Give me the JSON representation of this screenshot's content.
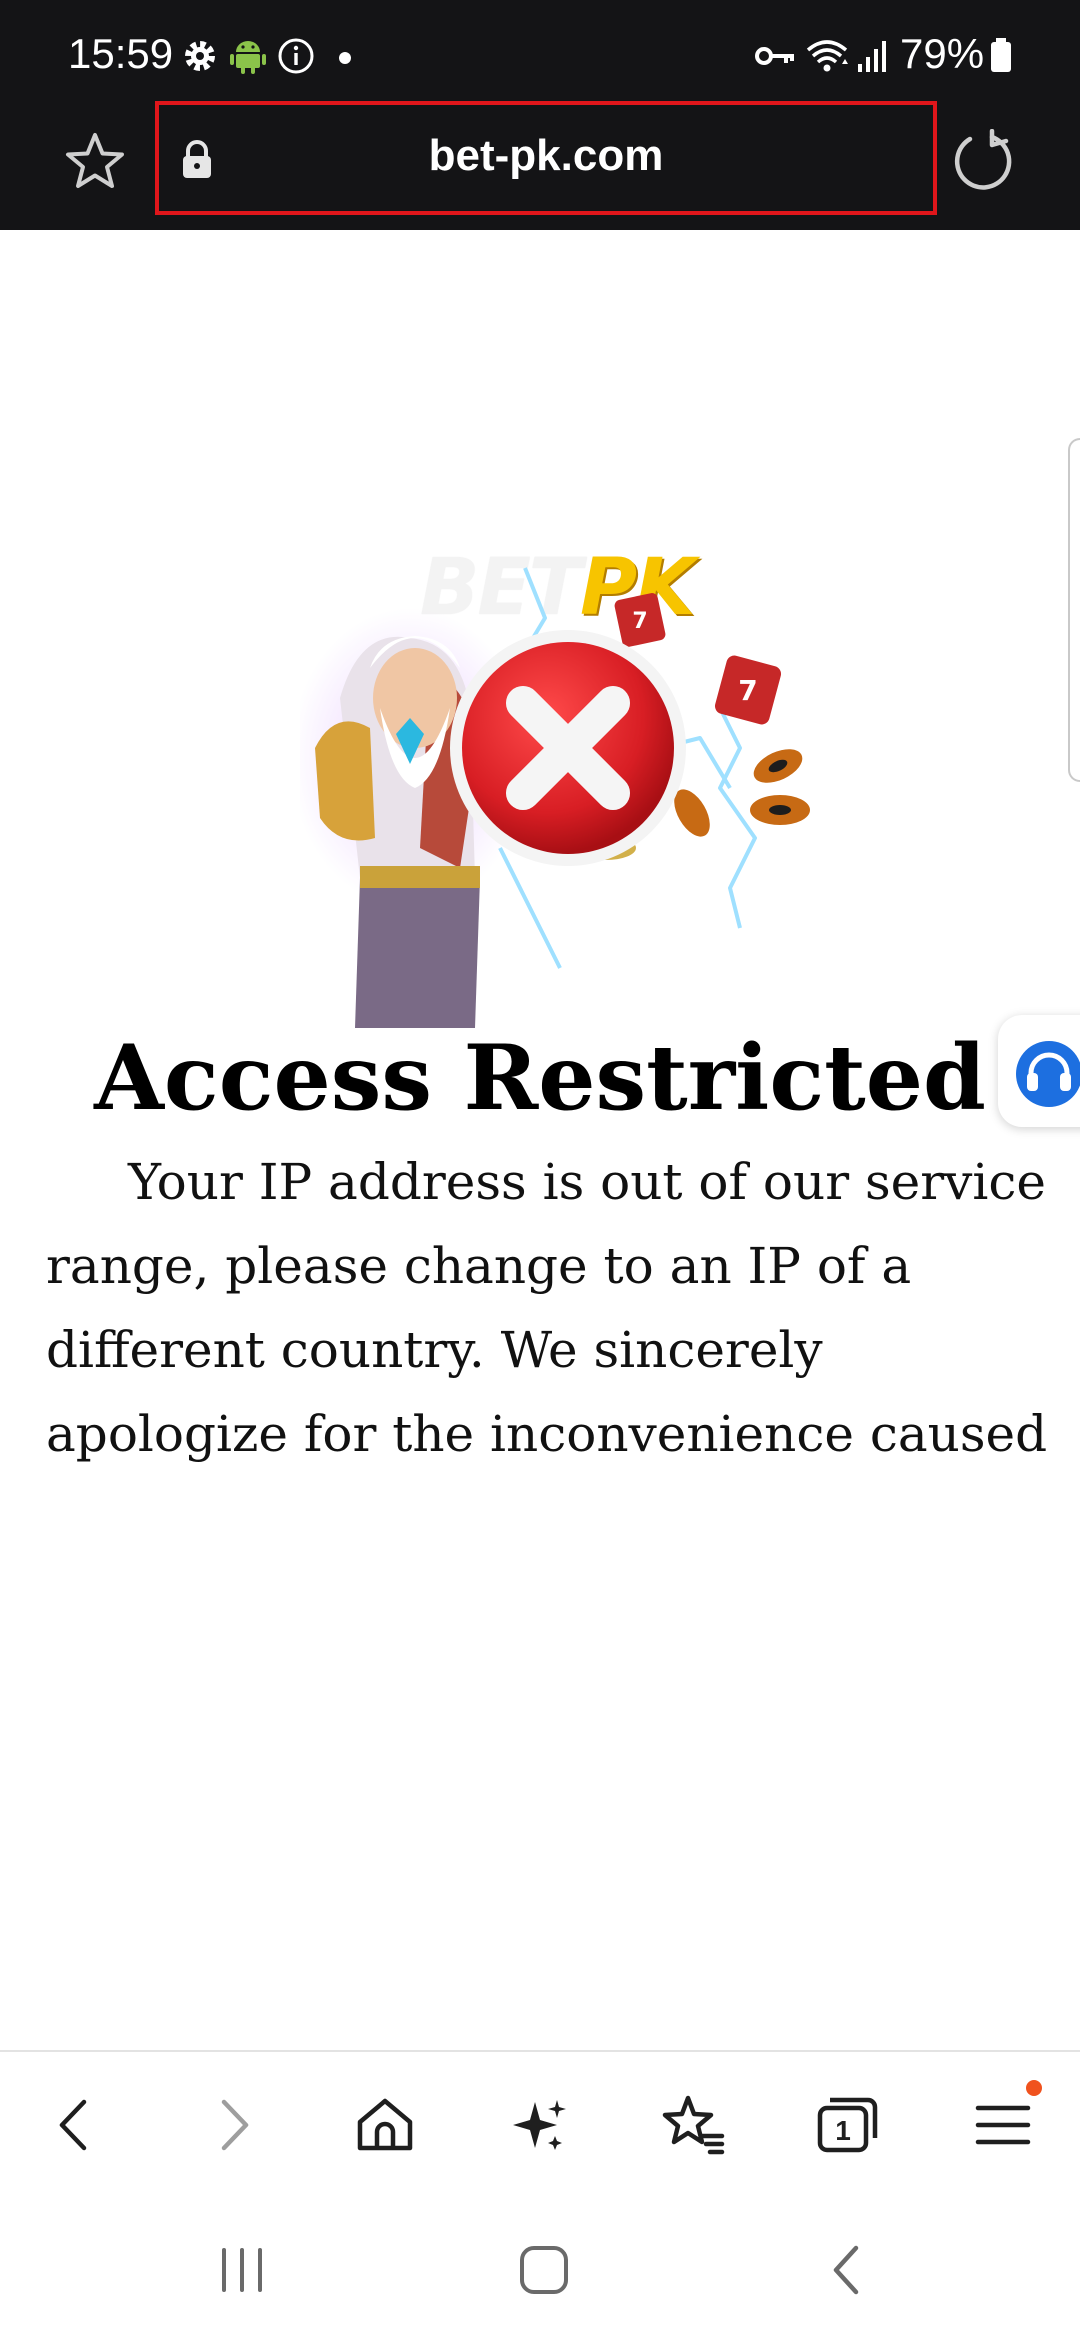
{
  "status_bar": {
    "time": "15:59",
    "battery": "79%",
    "icons": [
      "settings-icon",
      "android-icon",
      "info-icon",
      "notification-dot",
      "vpn-key-icon",
      "wifi-icon",
      "signal-icon",
      "battery-icon"
    ]
  },
  "toolbar": {
    "url": "bet-pk.com",
    "highlight_color": "#e0161b"
  },
  "page": {
    "logo": {
      "part1": "BET",
      "part2": "PK"
    },
    "title": "Access Restricted",
    "message": "Your IP address is out of our service range, please change to an IP of a different country. We sincerely apologize for the inconvenience caused"
  },
  "bottom_nav": {
    "tab_count": "1",
    "items": [
      "back-icon",
      "forward-icon",
      "home-icon",
      "sparkle-icon",
      "bookmarks-icon",
      "tabs-icon",
      "menu-icon"
    ],
    "badge_color": "#f0521e"
  },
  "system_nav": {
    "items": [
      "recents-icon",
      "home-button-icon",
      "back-icon"
    ]
  },
  "colors": {
    "chrome_bg": "#141416",
    "support_blue": "#1d6fe0",
    "error_red": "#d81e24"
  }
}
